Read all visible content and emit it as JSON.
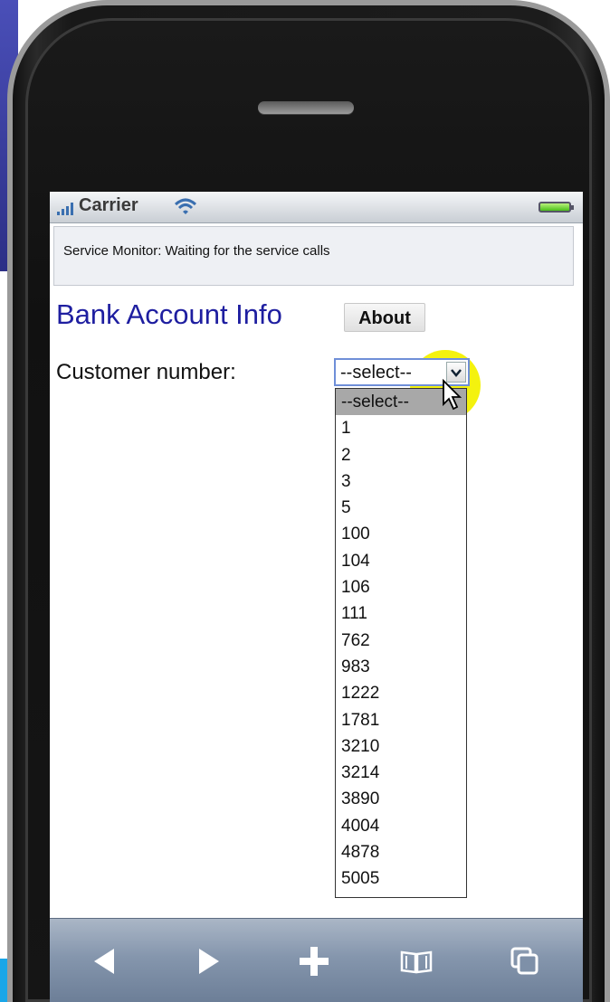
{
  "status_bar": {
    "carrier": "Carrier"
  },
  "service_monitor": {
    "text": "Service Monitor: Waiting for the service calls"
  },
  "page": {
    "title": "Bank Account Info",
    "about_button": "About",
    "customer_label": "Customer number:"
  },
  "customer_select": {
    "selected": "--select--",
    "options": [
      "--select--",
      "1",
      "2",
      "3",
      "5",
      "100",
      "104",
      "106",
      "111",
      "762",
      "983",
      "1222",
      "1781",
      "3210",
      "3214",
      "3890",
      "4004",
      "4878",
      "5005"
    ]
  },
  "toolbar": {
    "icons": [
      "back-arrow-icon",
      "forward-arrow-icon",
      "add-plus-icon",
      "bookmarks-book-icon",
      "pages-icon"
    ]
  },
  "colors": {
    "title": "#1e1ea0",
    "cursor_highlight": "#f4f20e",
    "toolbar": "#8596ad",
    "select_border": "#6f8fd8"
  }
}
